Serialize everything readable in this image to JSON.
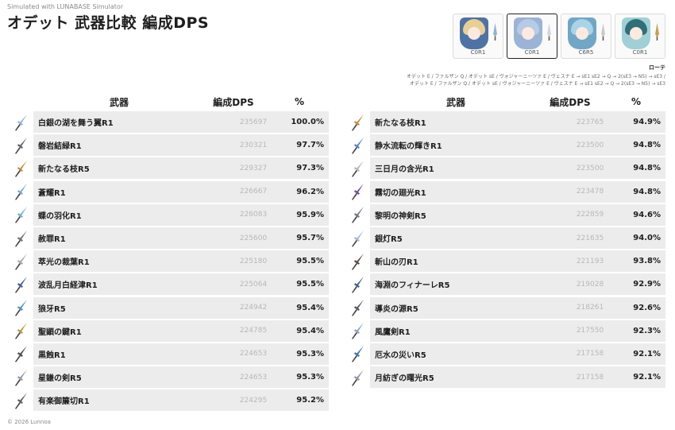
{
  "header": {
    "simulated_note": "Simulated with LUNABASE Simulator",
    "title": "オデット 武器比較 編成DPS"
  },
  "footer": {
    "copyright": "© 2026 Lunnoa"
  },
  "party": [
    {
      "constellation": "C0R1",
      "hair": "#e8cf93",
      "accent": "#4f72a6",
      "weapon_color": "#8fb3d9"
    },
    {
      "constellation": "C0R1",
      "hair": "#b6cbe6",
      "accent": "#9bb3d6",
      "weapon_color": "#cdd7e0"
    },
    {
      "constellation": "C6R5",
      "hair": "#a9d3e6",
      "accent": "#6fa7c7",
      "weapon_color": "#c9c9c9"
    },
    {
      "constellation": "C0R1",
      "hair": "#2f6f78",
      "accent": "#9fd0d6",
      "weapon_color": "#c2a44a"
    }
  ],
  "rotation": {
    "label": "ローテ",
    "line1": "オデット E / ファルザン Q / オデット sE / ヴォジャーニーツァ E / ヴェスナ E → sE1 sE2 → Q → 2(sE3 → N5) → sE3 /",
    "line2": "オデット E / ファルザン Q / オデット sE / ヴォジャーニーツァ E / ヴェスナ E → sE1 sE2 → Q → 2(sE3 → N5) → sE3"
  },
  "columns": {
    "weapon": "武器",
    "dps": "編成DPS",
    "pct": "%"
  },
  "tables": {
    "left": [
      {
        "name": "白銀の湖を舞う翼R1",
        "dps": "235697",
        "pct": "100.0%",
        "color": "#8fb3d9"
      },
      {
        "name": "磐岩結緑R1",
        "dps": "230321",
        "pct": "97.7%",
        "color": "#5a6470"
      },
      {
        "name": "新たなる枝R5",
        "dps": "229327",
        "pct": "97.3%",
        "color": "#c08a3e"
      },
      {
        "name": "蒼耀R1",
        "dps": "226667",
        "pct": "96.2%",
        "color": "#7aa6d6"
      },
      {
        "name": "蝶の羽化R1",
        "dps": "226083",
        "pct": "95.9%",
        "color": "#6cb3c9"
      },
      {
        "name": "赦罪R1",
        "dps": "225600",
        "pct": "95.7%",
        "color": "#6a6f78"
      },
      {
        "name": "萃光の裁葉R1",
        "dps": "225180",
        "pct": "95.5%",
        "color": "#a0a8b0"
      },
      {
        "name": "波乱月白経津R1",
        "dps": "225064",
        "pct": "95.5%",
        "color": "#3e5a9c"
      },
      {
        "name": "狼牙R5",
        "dps": "224942",
        "pct": "95.4%",
        "color": "#4d8fd0"
      },
      {
        "name": "聖顕の鍵R1",
        "dps": "224785",
        "pct": "95.4%",
        "color": "#b8953a"
      },
      {
        "name": "黒蝕R1",
        "dps": "224653",
        "pct": "95.3%",
        "color": "#4a4a55"
      },
      {
        "name": "星鎌の剣R5",
        "dps": "224653",
        "pct": "95.3%",
        "color": "#8f9aa8"
      },
      {
        "name": "有楽御簾切R1",
        "dps": "224295",
        "pct": "95.2%",
        "color": "#5c5c66"
      }
    ],
    "right": [
      {
        "name": "新たなる枝R1",
        "dps": "223765",
        "pct": "94.9%",
        "color": "#c08a3e"
      },
      {
        "name": "静水流転の輝きR1",
        "dps": "223500",
        "pct": "94.8%",
        "color": "#4d7fd0"
      },
      {
        "name": "三日月の含光R1",
        "dps": "223500",
        "pct": "94.8%",
        "color": "#b0b4bc"
      },
      {
        "name": "霧切の廻光R1",
        "dps": "223478",
        "pct": "94.8%",
        "color": "#6a4a9c"
      },
      {
        "name": "黎明の神剣R5",
        "dps": "222859",
        "pct": "94.6%",
        "color": "#6f7680"
      },
      {
        "name": "銀灯R5",
        "dps": "221635",
        "pct": "94.0%",
        "color": "#9fb6d0"
      },
      {
        "name": "斬山の刃R1",
        "dps": "221193",
        "pct": "93.8%",
        "color": "#5a4640"
      },
      {
        "name": "海淵のフィナーレR5",
        "dps": "219028",
        "pct": "92.9%",
        "color": "#3f5f8f"
      },
      {
        "name": "導炎の源R5",
        "dps": "218261",
        "pct": "92.6%",
        "color": "#4f5560"
      },
      {
        "name": "風鷹剣R1",
        "dps": "217550",
        "pct": "92.3%",
        "color": "#8aa0b8"
      },
      {
        "name": "厄水の災いR5",
        "dps": "217158",
        "pct": "92.1%",
        "color": "#3f6fb0"
      },
      {
        "name": "月紡ぎの曙光R5",
        "dps": "217158",
        "pct": "92.1%",
        "color": "#8a94a4"
      }
    ]
  }
}
